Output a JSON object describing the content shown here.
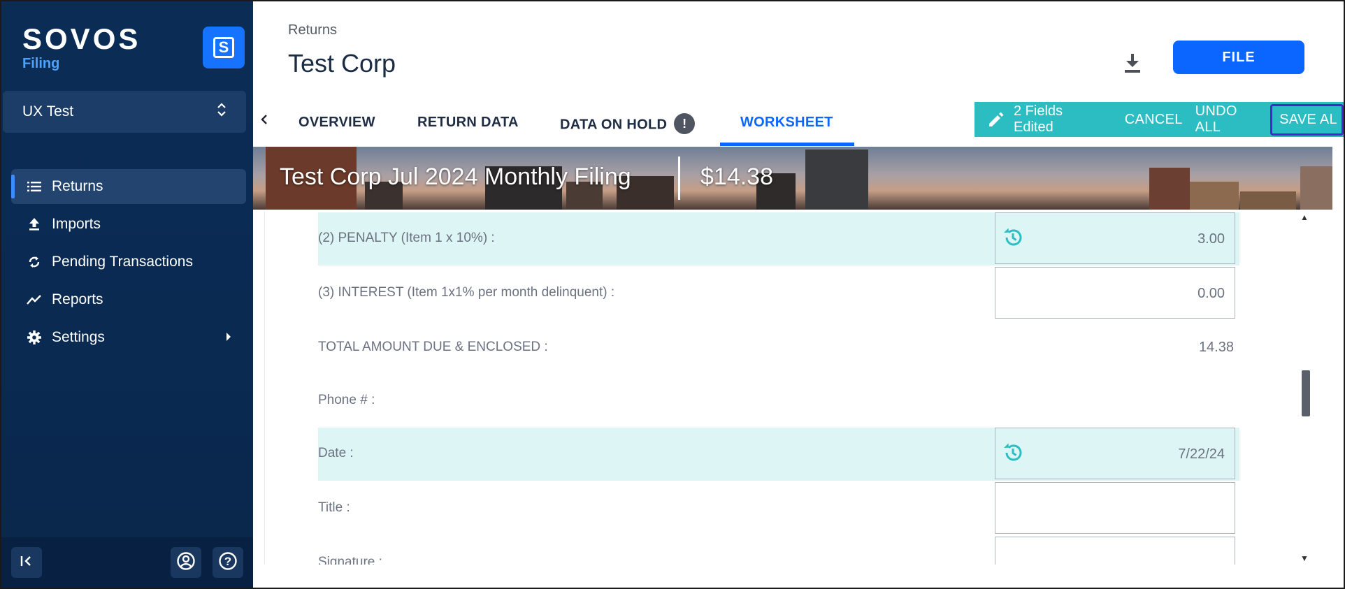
{
  "sidebar": {
    "logo_text": "SOVOS",
    "logo_sub": "Filing",
    "logo_badge": "S",
    "org": "UX Test",
    "nav": [
      {
        "label": "Returns",
        "icon": "list-icon"
      },
      {
        "label": "Imports",
        "icon": "upload-icon"
      },
      {
        "label": "Pending Transactions",
        "icon": "sync-icon"
      },
      {
        "label": "Reports",
        "icon": "trend-icon"
      },
      {
        "label": "Settings",
        "icon": "gear-icon"
      }
    ]
  },
  "header": {
    "breadcrumb": "Returns",
    "title": "Test Corp",
    "file_label": "FILE"
  },
  "tabs": {
    "items": [
      "OVERVIEW",
      "RETURN DATA",
      "DATA ON HOLD",
      "WORKSHEET"
    ],
    "active": "WORKSHEET",
    "hold_badge": "!"
  },
  "edit_bar": {
    "status": "2 Fields Edited",
    "cancel": "CANCEL",
    "undo_all": "UNDO ALL",
    "save_all": "SAVE AL"
  },
  "banner": {
    "title": "Test Corp Jul 2024 Monthly Filing",
    "amount": "$14.38"
  },
  "worksheet": {
    "rows": [
      {
        "label": "(2) PENALTY (Item 1 x 10%) :",
        "value": "3.00"
      },
      {
        "label": "(3) INTEREST (Item 1x1% per month delinquent) :",
        "value": "0.00"
      },
      {
        "label": "TOTAL AMOUNT DUE & ENCLOSED :",
        "value": "14.38"
      },
      {
        "label": "Phone # :",
        "value": ""
      },
      {
        "label": "Date :",
        "value": "7/22/24"
      },
      {
        "label": "Title :",
        "value": ""
      },
      {
        "label": "Signature :",
        "value": ""
      }
    ]
  },
  "colors": {
    "sidebar_bg": "#0b2c55",
    "accent": "#0a66ff",
    "edit_bar": "#2bbdc2",
    "edited_row": "#def5f5"
  }
}
